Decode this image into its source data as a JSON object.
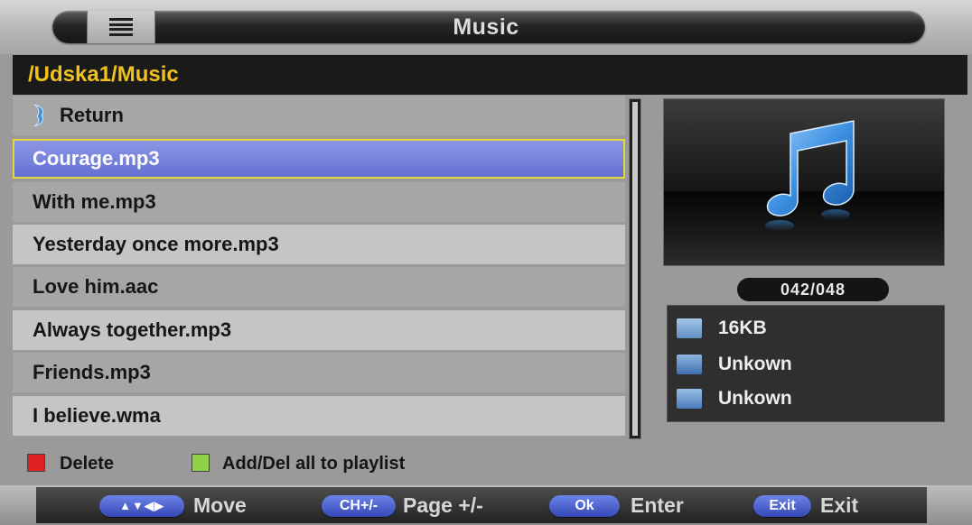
{
  "header": {
    "title": "Music",
    "menu_icon": "list-icon"
  },
  "path": "/Udska1/Music",
  "file_list": {
    "return_label": "Return",
    "items": [
      {
        "label": "Courage.mp3",
        "selected": true
      },
      {
        "label": "With me.mp3"
      },
      {
        "label": "Yesterday once more.mp3"
      },
      {
        "label": "Love him.aac"
      },
      {
        "label": "Always together.mp3"
      },
      {
        "label": "Friends.mp3"
      },
      {
        "label": "I believe.wma"
      }
    ],
    "selected_color": "#6470d2",
    "highlight_border": "#e4d83a"
  },
  "preview": {
    "icon": "music-note-icon",
    "counter": "042/048"
  },
  "info": {
    "size": "16KB",
    "artist": "Unkown",
    "album": "Unkown"
  },
  "hints": {
    "red_label": "Delete",
    "green_label": "Add/Del all to playlist",
    "red_color": "#e02222",
    "green_color": "#8fd24a"
  },
  "nav": {
    "move_key": "▲▼◀▶",
    "move_label": "Move",
    "page_key": "CH+/-",
    "page_label": "Page +/-",
    "ok_key": "Ok",
    "ok_label": "Enter",
    "exit_key": "Exit",
    "exit_label": "Exit"
  }
}
